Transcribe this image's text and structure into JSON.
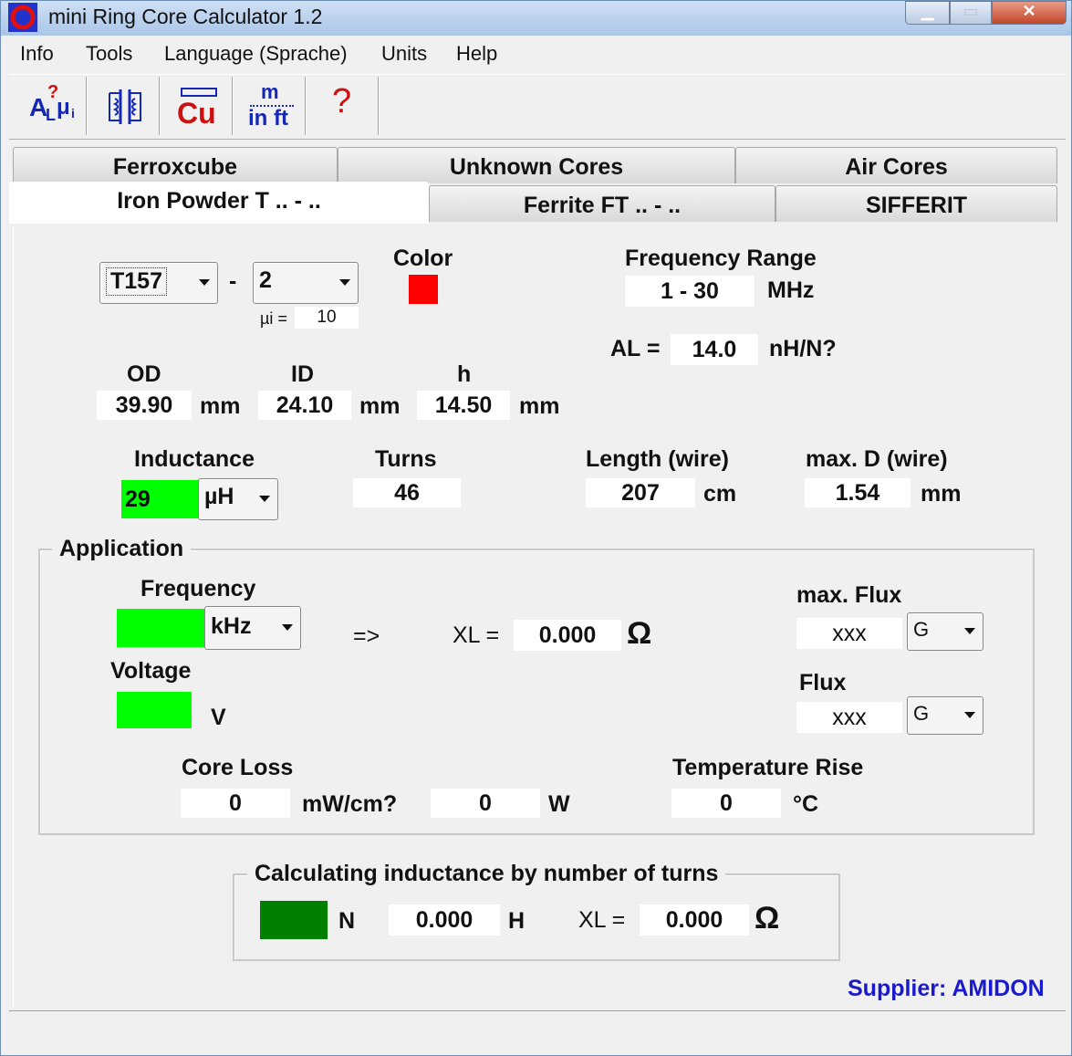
{
  "window": {
    "title": "mini Ring Core Calculator 1.2"
  },
  "menu": [
    "Info",
    "Tools",
    "Language (Sprache)",
    "Units",
    "Help"
  ],
  "toolbar": {
    "al_mu": {
      "main": "A",
      "sub": "L",
      "q": "?",
      "mu": "μ",
      "musub": "i"
    },
    "circuit": {},
    "copper": {
      "top": "⊟",
      "text": "Cu"
    },
    "units": {
      "top": "m",
      "bottom": "in ft"
    },
    "help": {
      "text": "?"
    }
  },
  "tabs": {
    "top": [
      "Ferroxcube",
      "Unknown Cores",
      "Air Cores"
    ],
    "bottom": [
      "Iron Powder T .. - ..",
      "Ferrite FT .. - ..",
      "SIFFERIT"
    ]
  },
  "core": {
    "size": "T157",
    "dash": "-",
    "mix": "2",
    "mu_label": "µi =",
    "mu_value": "10",
    "color_label": "Color",
    "color_hex": "#ff0000"
  },
  "freq_range": {
    "label": "Frequency Range",
    "value": "1 - 30",
    "unit": "MHz"
  },
  "al": {
    "label": "AL =",
    "value": "14.0",
    "unit": "nH/N?"
  },
  "dims": {
    "od": {
      "label": "OD",
      "value": "39.90",
      "unit": "mm"
    },
    "id": {
      "label": "ID",
      "value": "24.10",
      "unit": "mm"
    },
    "h": {
      "label": "h",
      "value": "14.50",
      "unit": "mm"
    }
  },
  "inductance": {
    "label": "Inductance",
    "value": "29",
    "unit": "µH"
  },
  "turns": {
    "label": "Turns",
    "value": "46"
  },
  "wire_length": {
    "label": "Length (wire)",
    "value": "207",
    "unit": "cm"
  },
  "wire_diam": {
    "label": "max. D (wire)",
    "value": "1.54",
    "unit": "mm"
  },
  "application": {
    "title": "Application",
    "frequency_label": "Frequency",
    "frequency_value": "",
    "frequency_unit": "kHz",
    "arrow": "=>",
    "xl_label": "XL =",
    "xl_value": "0.000",
    "ohm": "Ω",
    "voltage_label": "Voltage",
    "voltage_value": "",
    "voltage_unit": "V",
    "max_flux_label": "max. Flux",
    "max_flux_value": "xxx",
    "max_flux_unit": "G",
    "flux_label": "Flux",
    "flux_value": "xxx",
    "flux_unit": "G",
    "core_loss_label": "Core Loss",
    "core_loss_value": "0",
    "core_loss_unit": "mW/cm?",
    "loss_w_value": "0",
    "loss_w_unit": "W",
    "temp_label": "Temperature Rise",
    "temp_value": "0",
    "temp_unit": "°C"
  },
  "calc": {
    "title": "Calculating inductance by number of turns",
    "n_value": "",
    "n_label": "N",
    "h_value": "0.000",
    "h_unit": "H",
    "xl_label": "XL =",
    "xl_value": "0.000",
    "ohm": "Ω"
  },
  "supplier": "Supplier: AMIDON"
}
